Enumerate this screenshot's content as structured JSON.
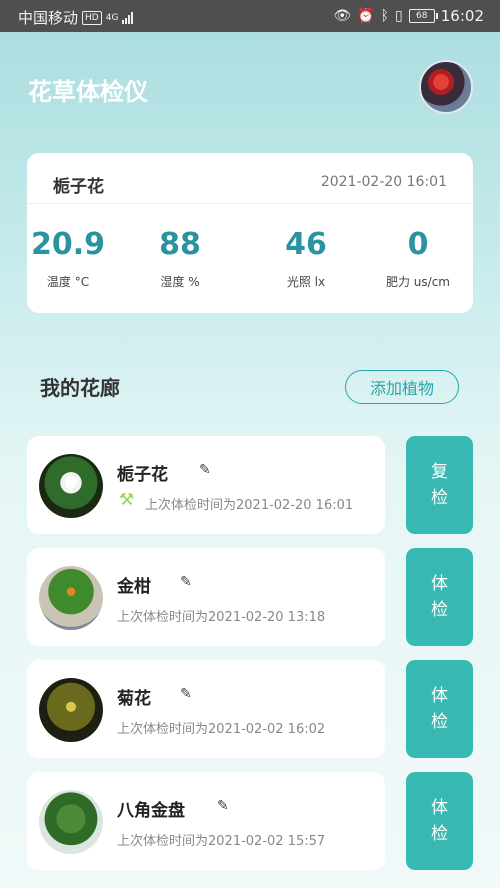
{
  "status_bar": {
    "carrier": "中国移动",
    "hd": "HD",
    "network": "4G",
    "battery": "68",
    "time": "16:02"
  },
  "header": {
    "title": "花草体检仪"
  },
  "current_check": {
    "plant_name": "栀子花",
    "datetime": "2021-02-20 16:01",
    "metrics": [
      {
        "value": "20.9",
        "label": "温度 °C"
      },
      {
        "value": "88",
        "label": "湿度 %"
      },
      {
        "value": "46",
        "label": "光照 lx"
      },
      {
        "value": "0",
        "label": "肥力 us/cm"
      }
    ]
  },
  "gallery": {
    "title": "我的花廊",
    "add_button": "添加植物",
    "plants": [
      {
        "name": "栀子花",
        "last_check": "上次体检时间为2021-02-20 16:01",
        "action": [
          "复",
          "检"
        ]
      },
      {
        "name": "金柑",
        "last_check": "上次体检时间为2021-02-20 13:18",
        "action": [
          "体",
          "检"
        ]
      },
      {
        "name": "菊花",
        "last_check": "上次体检时间为2021-02-02 16:02",
        "action": [
          "体",
          "检"
        ]
      },
      {
        "name": "八角金盘",
        "last_check": "上次体检时间为2021-02-02 15:57",
        "action": [
          "体",
          "检"
        ]
      }
    ]
  },
  "colors": {
    "accent": "#38b9b3",
    "metric_value": "#2a93a0",
    "status_bar": "#4f4f4f"
  }
}
